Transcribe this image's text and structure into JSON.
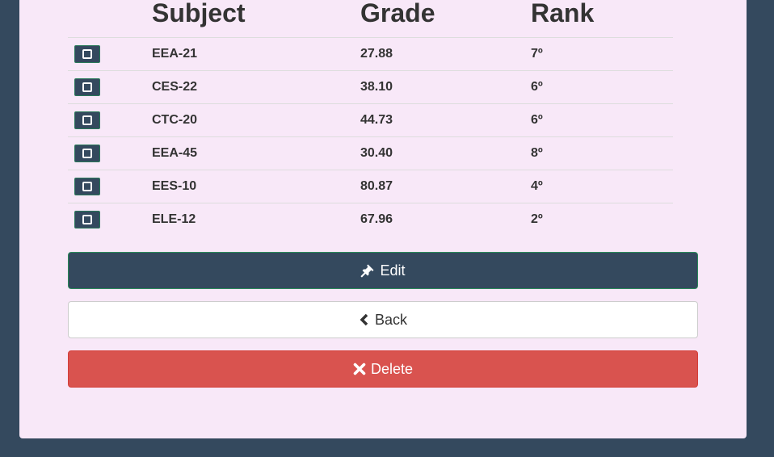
{
  "table": {
    "headers": {
      "subject": "Subject",
      "grade": "Grade",
      "rank": "Rank"
    },
    "rows": [
      {
        "subject": "EEA-21",
        "grade": "27.88",
        "rank": "7º"
      },
      {
        "subject": "CES-22",
        "grade": "38.10",
        "rank": "6º"
      },
      {
        "subject": "CTC-20",
        "grade": "44.73",
        "rank": "6º"
      },
      {
        "subject": "EEA-45",
        "grade": "30.40",
        "rank": "8º"
      },
      {
        "subject": "EES-10",
        "grade": "80.87",
        "rank": "4º"
      },
      {
        "subject": "ELE-12",
        "grade": "67.96",
        "rank": "2º"
      }
    ]
  },
  "actions": {
    "edit_label": "Edit",
    "back_label": "Back",
    "delete_label": "Delete",
    "edit_icon": "pushpin-icon",
    "back_icon": "chevron-left-icon",
    "delete_icon": "close-icon"
  },
  "colors": {
    "page_background": "#34495e",
    "panel_background": "#f8e8f8",
    "primary": "#34495e",
    "danger": "#d9534f"
  }
}
